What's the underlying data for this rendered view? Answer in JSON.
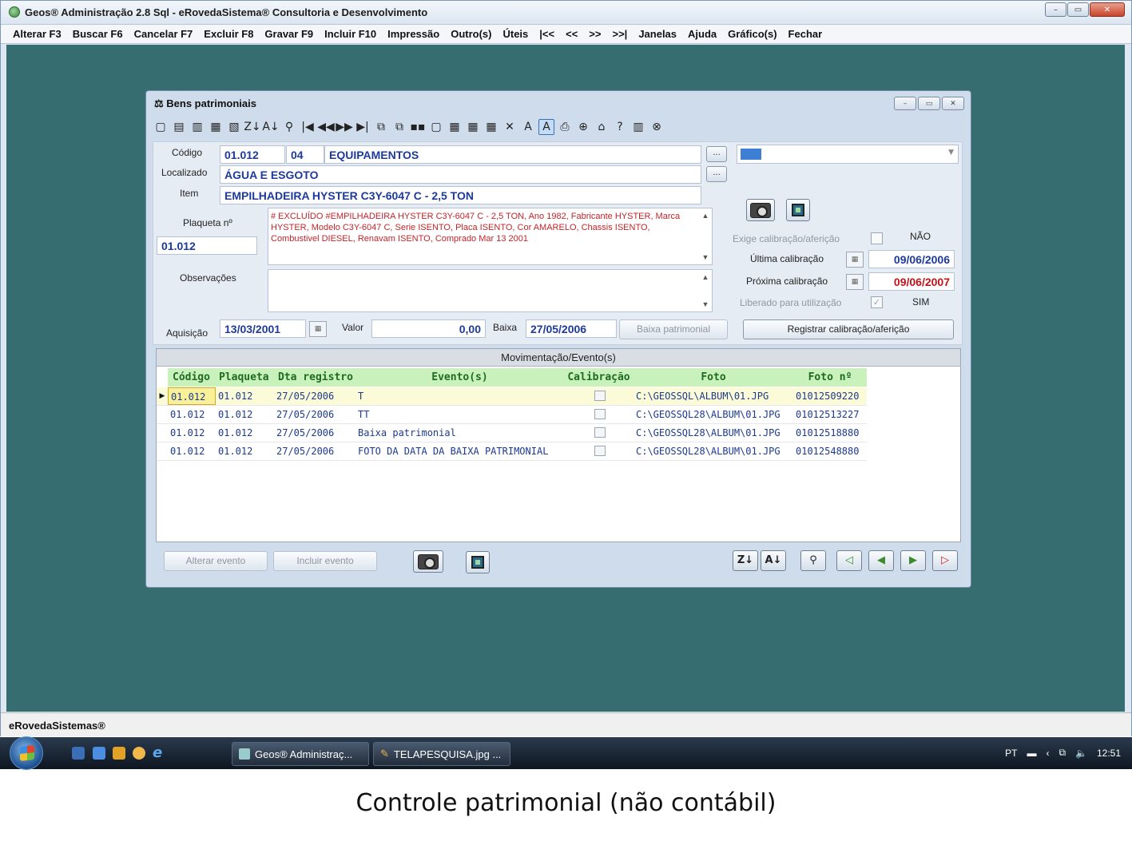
{
  "app": {
    "title": "Geos® Administração 2.8 Sql - eRovedaSistema® Consultoria e Desenvolvimento",
    "window_buttons": {
      "minimize": "–",
      "maximize": "▭",
      "close": "✕"
    }
  },
  "menu": [
    "Alterar F3",
    "Buscar F6",
    "Cancelar F7",
    "Excluir F8",
    "Gravar F9",
    "Incluir F10",
    "Impressão",
    "Outro(s)",
    "Úteis",
    "|<<",
    "<<",
    ">>",
    ">>|",
    "Janelas",
    "Ajuda",
    "Gráfico(s)",
    "Fechar"
  ],
  "child": {
    "title": "Bens patrimoniais",
    "window_buttons": {
      "minimize": "–",
      "maximize": "▭",
      "close": "✕"
    },
    "toolbar_glyphs": [
      "▢",
      "▤",
      "▥",
      "▦",
      "▧",
      "Z↓",
      "A↓",
      "⚲",
      "|◀",
      "◀◀",
      "▶▶",
      "▶|",
      "⧉",
      "⧉",
      "▪▪",
      "▢",
      "▦",
      "▦",
      "▦",
      "✕",
      "A",
      "A",
      "⎙",
      "⊕",
      "⌂",
      "?",
      "▥",
      "⊗"
    ],
    "form": {
      "codigo_label": "Código",
      "codigo": "01.012",
      "grupo": "04",
      "grupo_nome": "EQUIPAMENTOS",
      "localizado_label": "Localizado",
      "localizado": "ÁGUA E ESGOTO",
      "item_label": "Item",
      "item": "EMPILHADEIRA HYSTER C3Y-6047 C - 2,5 TON",
      "plaqueta_label": "Plaqueta nº",
      "plaqueta": "01.012",
      "descricao": "# EXCLUÍDO #EMPILHADEIRA HYSTER C3Y-6047 C - 2,5 TON, Ano 1982, Fabricante  HYSTER, Marca HYSTER, Modelo C3Y-6047 C, Serie ISENTO, Placa ISENTO, Cor AMARELO, Chassis ISENTO, Combustivel DIESEL, Renavam ISENTO, Comprado Mar 13 2001",
      "observacoes_label": "Observações",
      "observacoes": "",
      "aquisicao_label": "Aquisição",
      "aquisicao": "13/03/2001",
      "valor_label": "Valor",
      "valor": "0,00",
      "baixa_label": "Baixa",
      "baixa": "27/05/2006",
      "baixa_patrimonial_btn": "Baixa patrimonial",
      "ellipsis": "...",
      "exige_label": "Exige calibração/aferição",
      "exige_value": "NÃO",
      "ultima_label": "Última calibração",
      "ultima": "09/06/2006",
      "proxima_label": "Próxima calibração",
      "proxima": "09/06/2007",
      "liberado_label": "Liberado para utilização",
      "liberado_value": "SIM",
      "registrar_btn": "Registrar calibração/aferição",
      "color_swatch": "#3d7fd4"
    },
    "grid": {
      "caption": "Movimentação/Evento(s)",
      "columns": [
        "Código",
        "Plaqueta",
        "Dta registro",
        "Evento(s)",
        "Calibração",
        "Foto",
        "Foto nº"
      ],
      "rows": [
        {
          "codigo": "01.012",
          "plaqueta": "01.012",
          "data": "27/05/2006",
          "evento": "T",
          "calibracao": false,
          "foto": "C:\\GEOSSQL\\ALBUM\\01.JPG",
          "foto_n": "01012509220"
        },
        {
          "codigo": "01.012",
          "plaqueta": "01.012",
          "data": "27/05/2006",
          "evento": "TT",
          "calibracao": false,
          "foto": "C:\\GEOSSQL28\\ALBUM\\01.JPG",
          "foto_n": "01012513227"
        },
        {
          "codigo": "01.012",
          "plaqueta": "01.012",
          "data": "27/05/2006",
          "evento": "Baixa patrimonial",
          "calibracao": false,
          "foto": "C:\\GEOSSQL28\\ALBUM\\01.JPG",
          "foto_n": "01012518880"
        },
        {
          "codigo": "01.012",
          "plaqueta": "01.012",
          "data": "27/05/2006",
          "evento": "FOTO DA DATA DA BAIXA PATRIMONIAL",
          "calibracao": false,
          "foto": "C:\\GEOSSQL28\\ALBUM\\01.JPG",
          "foto_n": "01012548880"
        }
      ]
    },
    "bottom": {
      "alterar_evento": "Alterar evento",
      "incluir_evento": "Incluir evento",
      "nav": [
        "Z↓",
        "A↓",
        "⚲",
        "◁",
        "◀",
        "▶",
        "▷"
      ]
    }
  },
  "statusbar": "eRovedaSistemas®",
  "taskbar": {
    "buttons": [
      "Geos® Administraç...",
      "TELAPESQUISA.jpg ..."
    ],
    "lang": "PT",
    "clock": "12:51"
  },
  "caption": "Controle patrimonial (não contábil)"
}
